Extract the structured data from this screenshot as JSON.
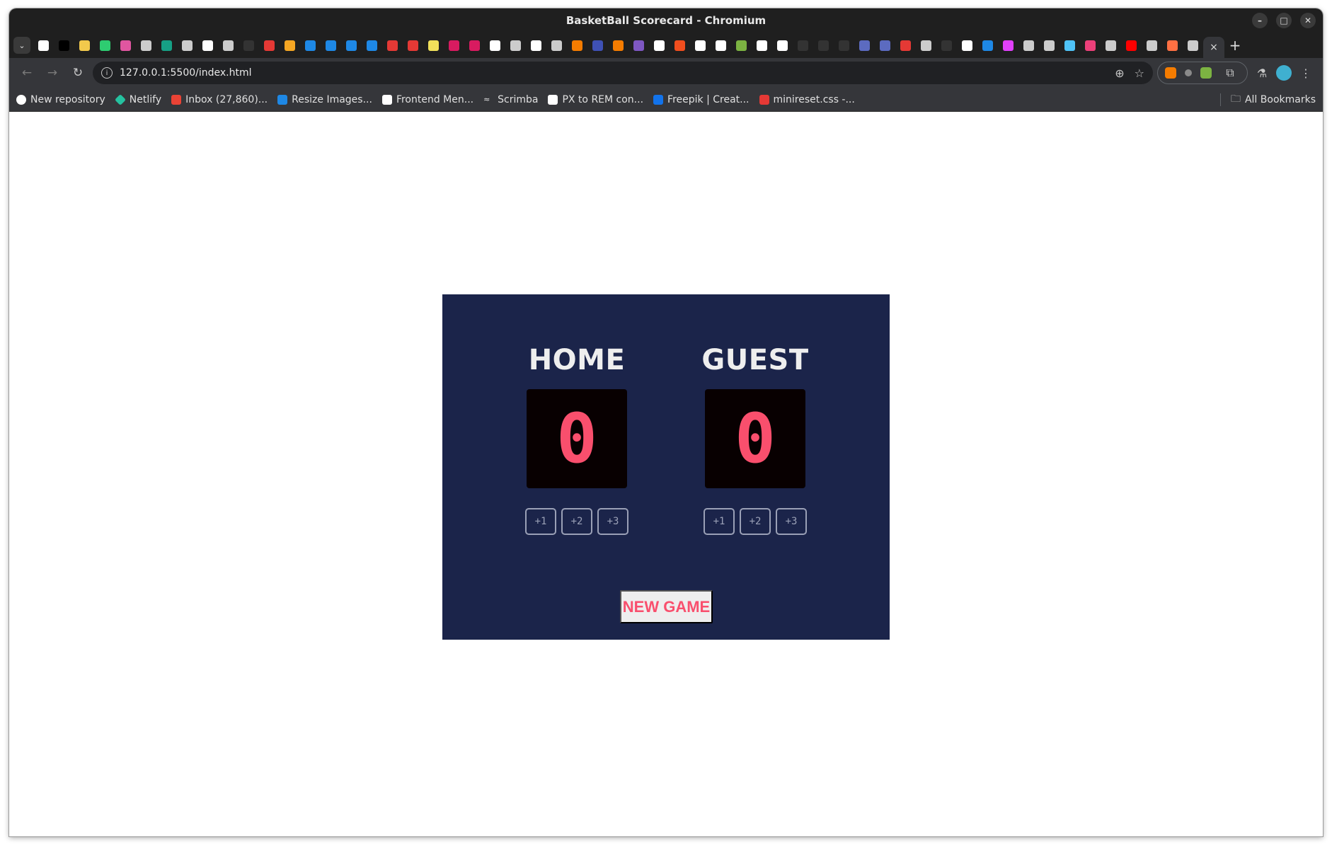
{
  "window": {
    "title": "BasketBall Scorecard - Chromium"
  },
  "tabstrip": {
    "favicons": [
      "#ffffff",
      "#000000",
      "#f2c94c",
      "#2ecc71",
      "#e056a0",
      "#cccccc",
      "#16a085",
      "#cccccc",
      "#ffffff",
      "#cccccc",
      "#333333",
      "#e53935",
      "#f5a623",
      "#1e88e5",
      "#1e88e5",
      "#1e88e5",
      "#1e88e5",
      "#e53935",
      "#e53935",
      "#f1e05a",
      "#d81b60",
      "#d81b60",
      "#ffffff",
      "#cccccc",
      "#ffffff",
      "#cccccc",
      "#f57c00",
      "#3f51b5",
      "#f57c00",
      "#7e57c2",
      "#ffffff",
      "#f24e1e",
      "#ffffff",
      "#ffffff",
      "#7cb342",
      "#ffffff",
      "#ffffff",
      "#333333",
      "#333333",
      "#333333",
      "#5c6bc0",
      "#5c6bc0",
      "#e53935",
      "#cccccc",
      "#333333",
      "#ffffff",
      "#1e88e5",
      "#e040fb",
      "#cccccc",
      "#cccccc",
      "#4fc3f7",
      "#ec407a",
      "#cccccc",
      "#ff0000",
      "#cccccc",
      "#ff7043",
      "#cccccc"
    ],
    "active_close": "×",
    "new_tab": "+"
  },
  "toolbar": {
    "url": "127.0.0.1:5500/index.html"
  },
  "bookmarks": {
    "items": [
      {
        "label": "New repository",
        "color": "#ffffff"
      },
      {
        "label": "Netlify",
        "color": "#25c2a0"
      },
      {
        "label": "Inbox (27,860)...",
        "color": "#ea4335"
      },
      {
        "label": "Resize Images...",
        "color": "#1e88e5"
      },
      {
        "label": "Frontend Men...",
        "color": "#ffffff"
      },
      {
        "label": "Scrimba",
        "color": "#e0e0e0"
      },
      {
        "label": "PX to REM con...",
        "color": "#ffffff"
      },
      {
        "label": "Freepik | Creat...",
        "color": "#1273eb"
      },
      {
        "label": "minireset.css -...",
        "color": "#e53935"
      }
    ],
    "all_bookmarks": "All Bookmarks"
  },
  "scoreboard": {
    "home": {
      "name": "HOME",
      "score": "0",
      "buttons": [
        "+1",
        "+2",
        "+3"
      ]
    },
    "guest": {
      "name": "GUEST",
      "score": "0",
      "buttons": [
        "+1",
        "+2",
        "+3"
      ]
    },
    "new_game": "NEW GAME"
  },
  "colors": {
    "board_bg": "#1b244a",
    "score_bg": "#080001",
    "accent": "#f94f6d"
  }
}
